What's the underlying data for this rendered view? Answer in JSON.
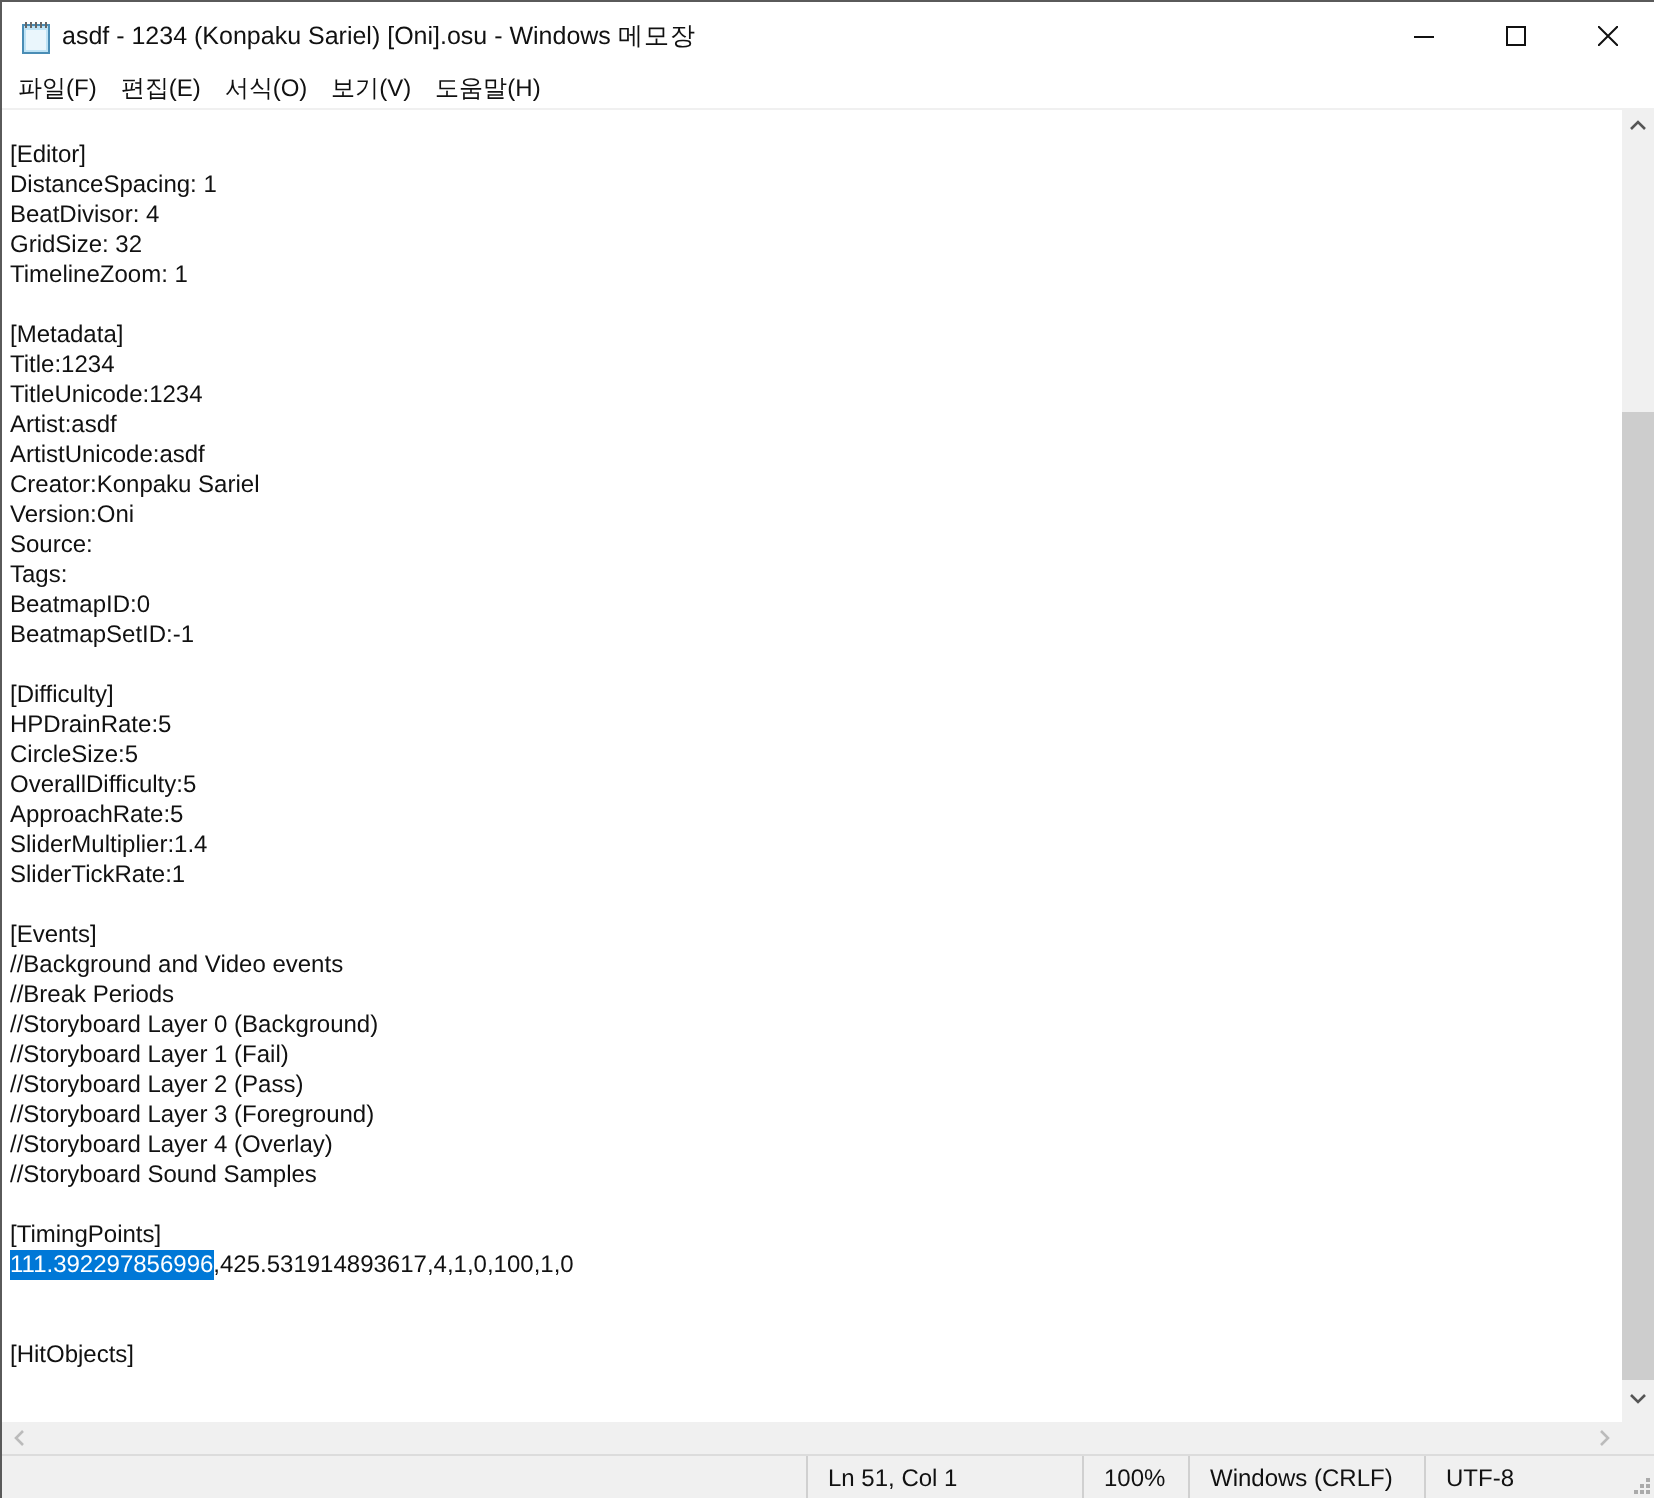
{
  "window": {
    "title": "asdf - 1234 (Konpaku Sariel) [Oni].osu - Windows 메모장"
  },
  "menu": [
    "파일(F)",
    "편집(E)",
    "서식(O)",
    "보기(V)",
    "도움말(H)"
  ],
  "editor": {
    "lines": [
      {
        "kind": "blank"
      },
      {
        "kind": "text",
        "text": "[Editor]"
      },
      {
        "kind": "text",
        "text": "DistanceSpacing: 1"
      },
      {
        "kind": "text",
        "text": "BeatDivisor: 4"
      },
      {
        "kind": "text",
        "text": "GridSize: 32"
      },
      {
        "kind": "text",
        "text": "TimelineZoom: 1"
      },
      {
        "kind": "blank"
      },
      {
        "kind": "text",
        "text": "[Metadata]"
      },
      {
        "kind": "text",
        "text": "Title:1234"
      },
      {
        "kind": "text",
        "text": "TitleUnicode:1234"
      },
      {
        "kind": "text",
        "text": "Artist:asdf"
      },
      {
        "kind": "text",
        "text": "ArtistUnicode:asdf"
      },
      {
        "kind": "text",
        "text": "Creator:Konpaku Sariel"
      },
      {
        "kind": "text",
        "text": "Version:Oni"
      },
      {
        "kind": "text",
        "text": "Source:"
      },
      {
        "kind": "text",
        "text": "Tags:"
      },
      {
        "kind": "text",
        "text": "BeatmapID:0"
      },
      {
        "kind": "text",
        "text": "BeatmapSetID:-1"
      },
      {
        "kind": "blank"
      },
      {
        "kind": "text",
        "text": "[Difficulty]"
      },
      {
        "kind": "text",
        "text": "HPDrainRate:5"
      },
      {
        "kind": "text",
        "text": "CircleSize:5"
      },
      {
        "kind": "text",
        "text": "OverallDifficulty:5"
      },
      {
        "kind": "text",
        "text": "ApproachRate:5"
      },
      {
        "kind": "text",
        "text": "SliderMultiplier:1.4"
      },
      {
        "kind": "text",
        "text": "SliderTickRate:1"
      },
      {
        "kind": "blank"
      },
      {
        "kind": "text",
        "text": "[Events]"
      },
      {
        "kind": "text",
        "text": "//Background and Video events"
      },
      {
        "kind": "text",
        "text": "//Break Periods"
      },
      {
        "kind": "text",
        "text": "//Storyboard Layer 0 (Background)"
      },
      {
        "kind": "text",
        "text": "//Storyboard Layer 1 (Fail)"
      },
      {
        "kind": "text",
        "text": "//Storyboard Layer 2 (Pass)"
      },
      {
        "kind": "text",
        "text": "//Storyboard Layer 3 (Foreground)"
      },
      {
        "kind": "text",
        "text": "//Storyboard Layer 4 (Overlay)"
      },
      {
        "kind": "text",
        "text": "//Storyboard Sound Samples"
      },
      {
        "kind": "blank"
      },
      {
        "kind": "text",
        "text": "[TimingPoints]"
      },
      {
        "kind": "selection",
        "selected_text": "111.392297856996",
        "text": ",425.531914893617,4,1,0,100,1,0"
      },
      {
        "kind": "blank"
      },
      {
        "kind": "blank"
      },
      {
        "kind": "text",
        "text": "[HitObjects]"
      }
    ]
  },
  "status_bar": [
    "Ln 51, Col 1",
    "100%",
    "Windows (CRLF)",
    "UTF-8"
  ]
}
